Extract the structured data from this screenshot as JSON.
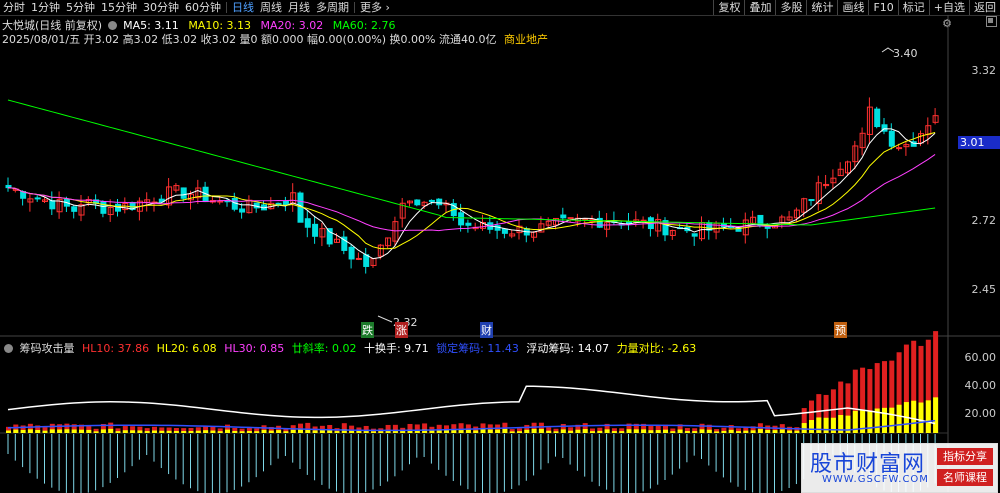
{
  "toolbar": {
    "periods": [
      "分时",
      "1分钟",
      "5分钟",
      "15分钟",
      "30分钟",
      "60分钟",
      "日线",
      "周线",
      "月线",
      "多周期",
      "更多"
    ],
    "active_period": "日线",
    "more_label": "更多",
    "right_buttons": [
      "复权",
      "叠加",
      "多股",
      "统计",
      "画线",
      "F10",
      "标记",
      "+自选",
      "返回"
    ]
  },
  "stock": {
    "name": "大悦城(日线 前复权)",
    "ma5": "MA5: 3.11",
    "ma10": "MA10: 3.13",
    "ma20": "MA20: 3.02",
    "ma60": "MA60: 2.76",
    "info_line": "2025/08/01/五 开3.02 高3.02 低3.02 收3.02 量0 额0.000 幅0.00(0.00%) 换0.00% 流通40.0亿",
    "sector": "商业地产"
  },
  "axis": {
    "price_labels": [
      "3.32",
      "2.72",
      "2.45"
    ],
    "current_price": "3.01",
    "high_mark": "3.40",
    "low_mark": "2.32",
    "indicator_labels": [
      "60.00",
      "40.00",
      "20.00"
    ]
  },
  "events": [
    "跌",
    "涨",
    "财",
    "预"
  ],
  "indicator": {
    "name": "筹码攻击量",
    "hl10": "HL10: 37.86",
    "hl20": "HL20: 6.08",
    "hl30": "HL30: 0.85",
    "gongliu": "廿斜率: 0.02",
    "shihuan": "十换手: 9.71",
    "suoding": "锁定筹码: 11.43",
    "fudong": "浮动筹码: 14.07",
    "liliang": "力量对比: -2.63"
  },
  "watermark": {
    "title": "股市财富网",
    "url": "WWW.GSCFW.COM",
    "tag1": "指标分享",
    "tag2": "名师课程"
  },
  "colors": {
    "up": "#ff3030",
    "down": "#00e0e0",
    "ma5": "#ffffff",
    "ma10": "#ffff00",
    "ma20": "#ff40ff",
    "ma60": "#00ff00",
    "accent": "#1a2cc8"
  }
}
